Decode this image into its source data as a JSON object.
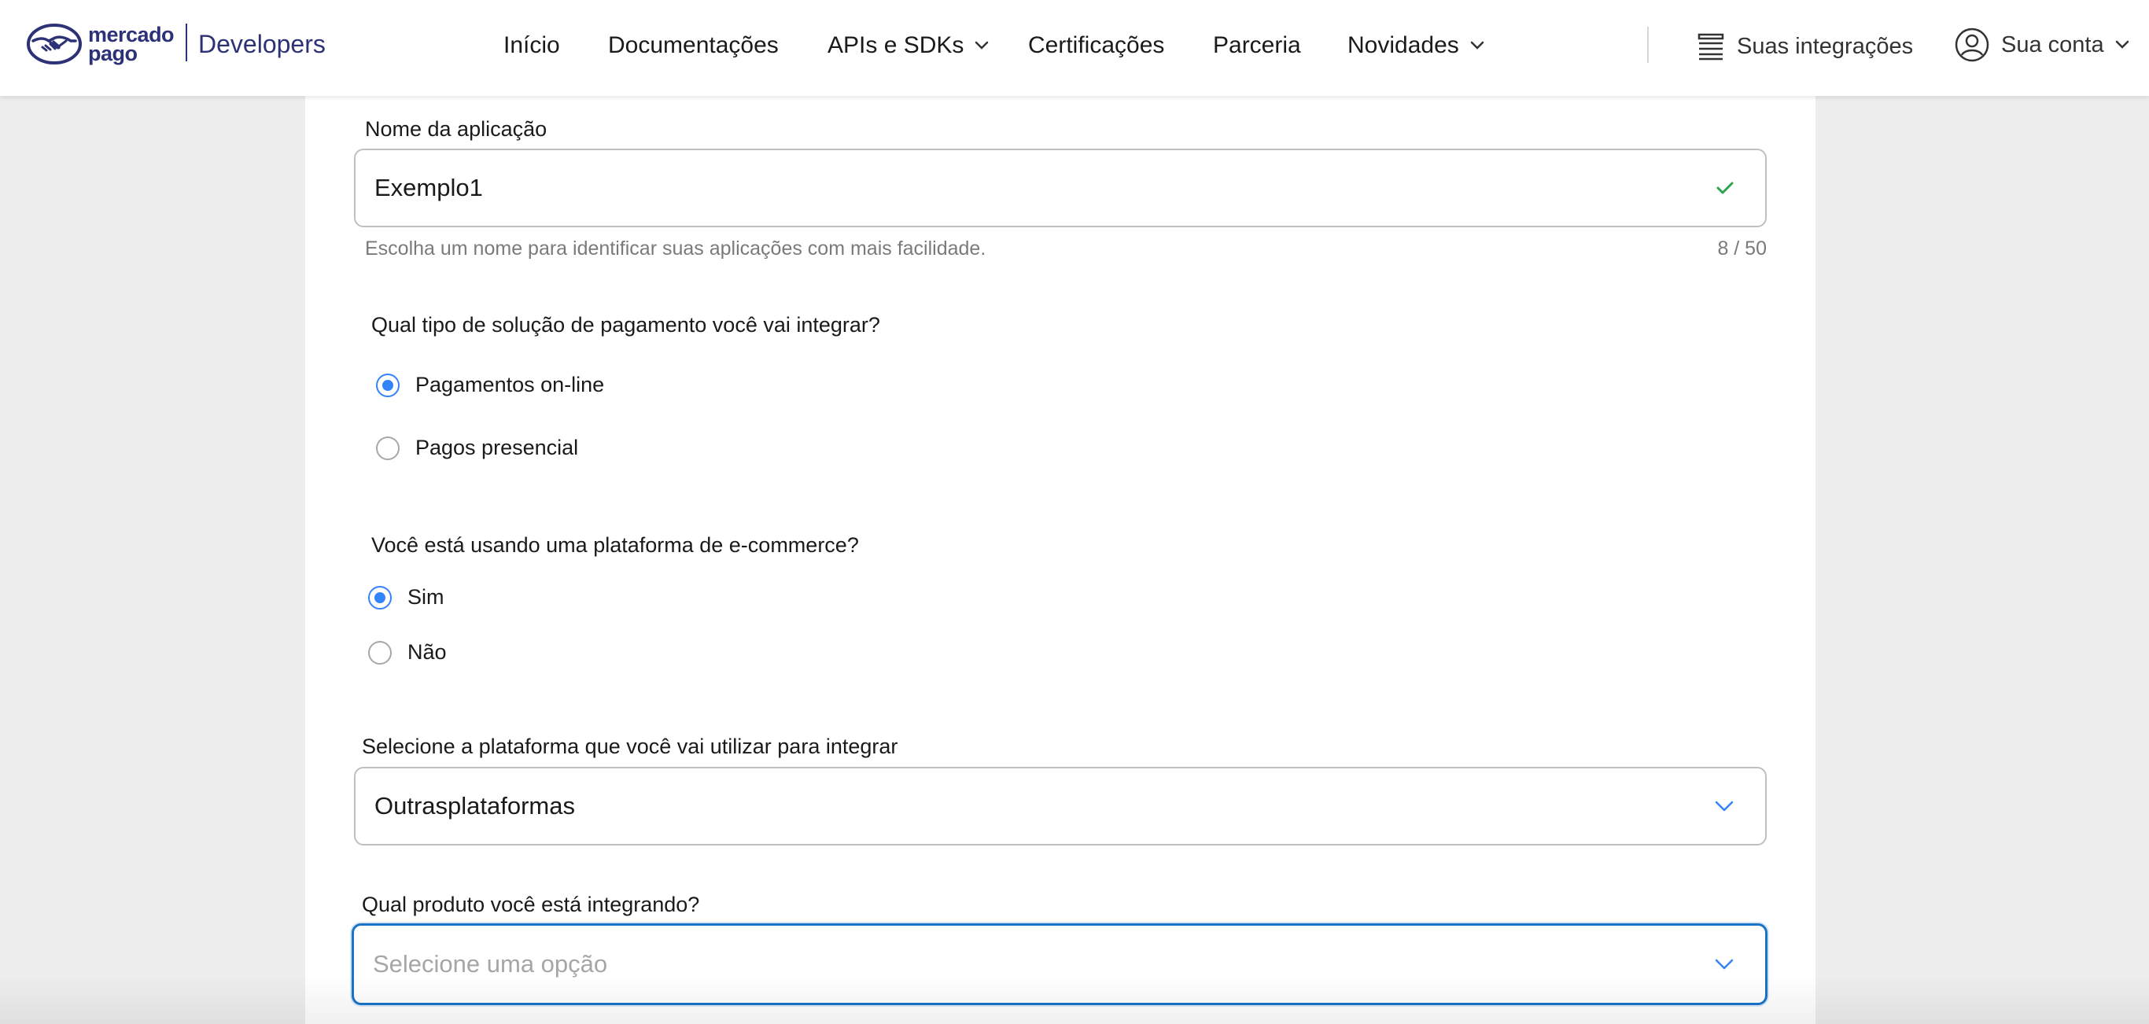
{
  "brand": {
    "name_line1": "mercado",
    "name_line2": "pago",
    "product": "Developers",
    "color": "#2d3277"
  },
  "nav": {
    "items": [
      {
        "label": "Início",
        "has_dropdown": false
      },
      {
        "label": "Documentações",
        "has_dropdown": false
      },
      {
        "label": "APIs e SDKs",
        "has_dropdown": true
      },
      {
        "label": "Certificações",
        "has_dropdown": false
      },
      {
        "label": "Parceria",
        "has_dropdown": false
      },
      {
        "label": "Novidades",
        "has_dropdown": true
      }
    ],
    "integrations_label": "Suas integrações",
    "account_label": "Sua conta"
  },
  "form": {
    "app_name": {
      "label": "Nome da aplicação",
      "value": "Exemplo1",
      "helper": "Escolha um nome para identificar suas aplicações com mais facilidade.",
      "counter": "8 / 50",
      "valid_icon": "check-icon"
    },
    "payment_type": {
      "question": "Qual tipo de solução de pagamento você vai integrar?",
      "options": [
        {
          "label": "Pagamentos on-line",
          "checked": true
        },
        {
          "label": "Pagos presencial",
          "checked": false
        }
      ]
    },
    "ecommerce": {
      "question": "Você está usando uma plataforma de e-commerce?",
      "options": [
        {
          "label": "Sim",
          "checked": true
        },
        {
          "label": "Não",
          "checked": false
        }
      ]
    },
    "platform": {
      "label": "Selecione a plataforma que você vai utilizar para integrar",
      "value": "Outrasplataformas"
    },
    "product": {
      "label": "Qual produto você está integrando?",
      "placeholder": "Selecione uma opção"
    }
  },
  "colors": {
    "accent": "#3483fa",
    "focus_border": "#1a73c6",
    "valid_check": "#2ea44f",
    "chevron": "#3483fa"
  }
}
